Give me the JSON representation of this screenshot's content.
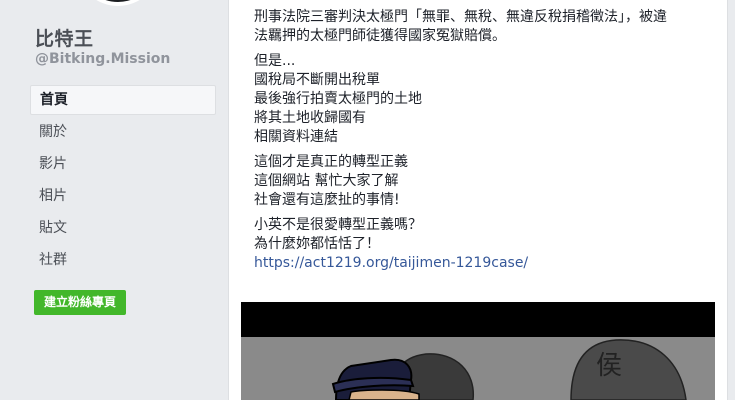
{
  "page": {
    "name": "比特王",
    "handle": "@Bitking.Mission"
  },
  "nav": {
    "items": [
      {
        "label": "首頁",
        "active": true
      },
      {
        "label": "關於"
      },
      {
        "label": "影片"
      },
      {
        "label": "相片"
      },
      {
        "label": "貼文"
      },
      {
        "label": "社群"
      }
    ],
    "create_button": "建立粉絲專頁"
  },
  "post": {
    "para1": [
      "刑事法院三審判決太極門「無罪、無稅、無違反稅捐稽徵法」，被違",
      "法羈押的太極門師徒獲得國家冤獄賠償。"
    ],
    "para2": [
      "但是...",
      "國稅局不斷開出稅單",
      "最後強行拍賣太極門的土地",
      "將其土地收歸國有",
      "相關資料連結"
    ],
    "para3": [
      "這個才是真正的轉型正義",
      "這個網站 幫忙大家了解",
      "社會還有這麼扯的事情!"
    ],
    "para4": [
      "小英不是很愛轉型正義嗎？",
      "為什麼妳都恬恬了！"
    ],
    "link": "https://act1219.org/taijimen-1219case/",
    "image_text": "侯"
  },
  "colors": {
    "background": "#e9ebee",
    "create_button": "#42b72a",
    "link": "#365899"
  }
}
